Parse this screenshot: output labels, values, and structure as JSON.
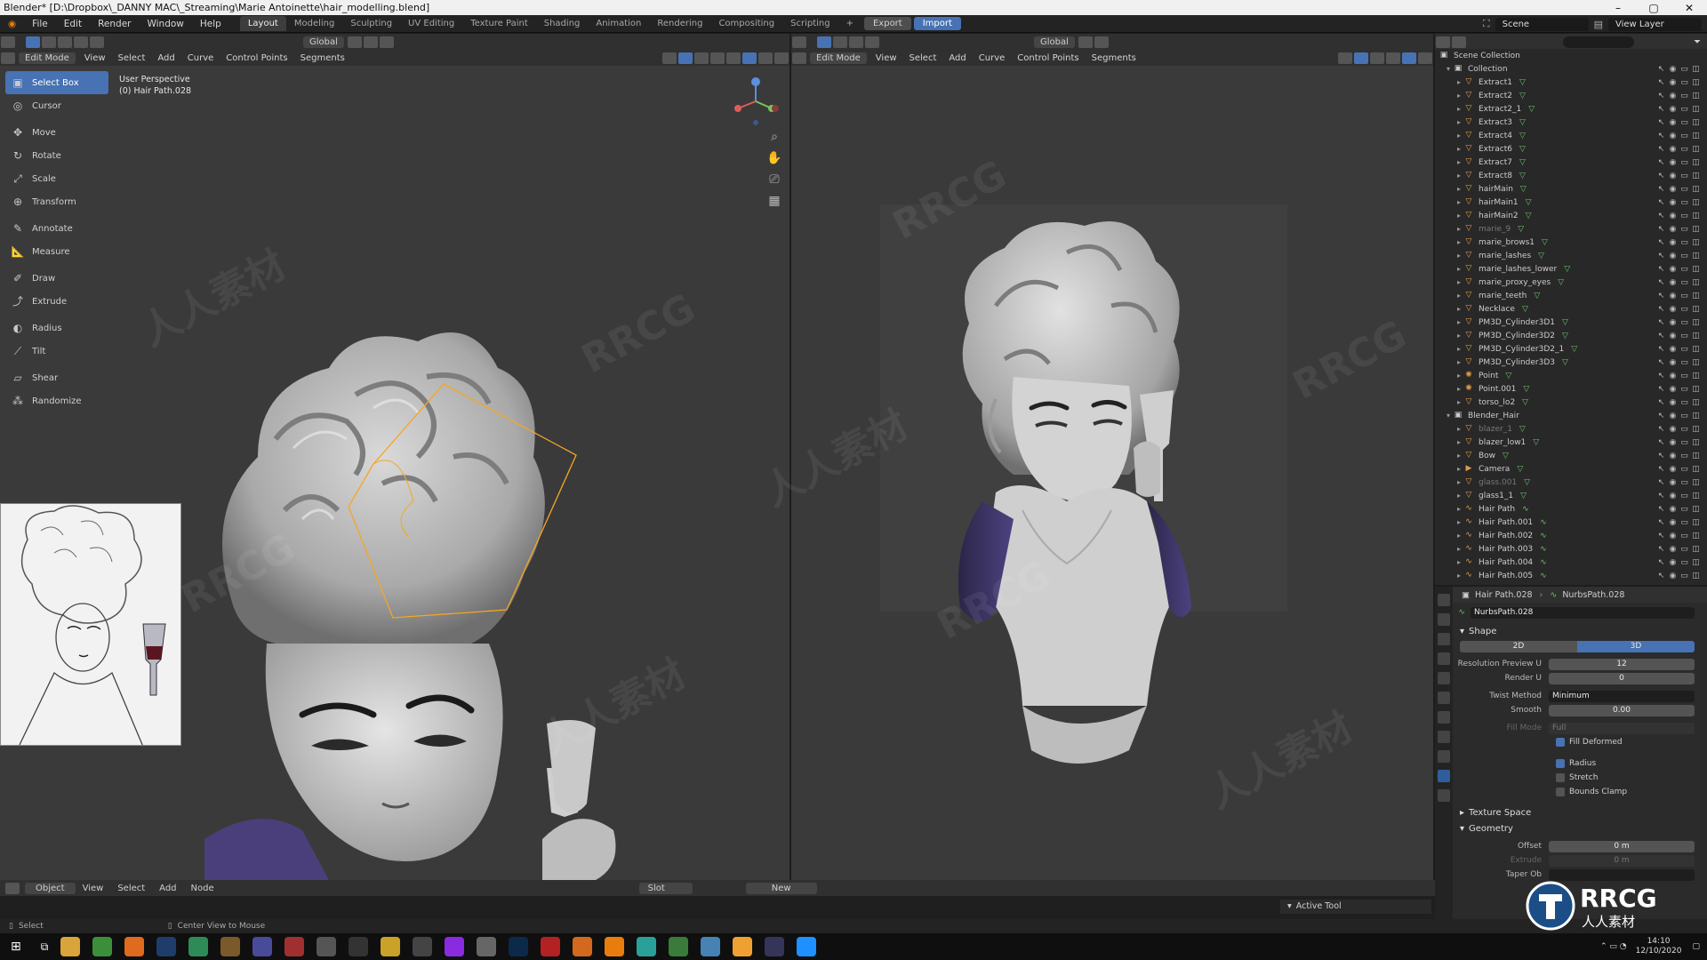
{
  "window": {
    "title": "Blender* [D:\\Dropbox\\_DANNY MAC\\_Streaming\\Marie Antoinette\\hair_modelling.blend]",
    "controls": [
      "–",
      "▢",
      "✕"
    ]
  },
  "topbar": {
    "menus": [
      "File",
      "Edit",
      "Render",
      "Window",
      "Help"
    ],
    "workspaces": [
      "Layout",
      "Modeling",
      "Sculpting",
      "UV Editing",
      "Texture Paint",
      "Shading",
      "Animation",
      "Rendering",
      "Compositing",
      "Scripting"
    ],
    "active_workspace": "Layout",
    "add_tab": "+",
    "export_label": "Export",
    "import_label": "Import",
    "scene_label": "Scene",
    "view_layer_label": "View Layer"
  },
  "left_view": {
    "mode": "Edit Mode",
    "menus": [
      "View",
      "Select",
      "Add",
      "Curve",
      "Control Points",
      "Segments"
    ],
    "orientation": "Global",
    "perspective": "User Perspective",
    "object": "(0) Hair Path.028"
  },
  "right_view": {
    "mode": "Edit Mode",
    "menus": [
      "View",
      "Select",
      "Add",
      "Curve",
      "Control Points",
      "Segments"
    ],
    "orientation": "Global"
  },
  "tools": [
    {
      "label": "Select Box",
      "icon": "▣",
      "active": true
    },
    {
      "label": "Cursor",
      "icon": "◎"
    },
    {
      "label": "Move",
      "icon": "✥"
    },
    {
      "label": "Rotate",
      "icon": "↻"
    },
    {
      "label": "Scale",
      "icon": "⤢"
    },
    {
      "label": "Transform",
      "icon": "⊕"
    },
    {
      "label": "Annotate",
      "icon": "✎"
    },
    {
      "label": "Measure",
      "icon": "📐"
    },
    {
      "label": "Draw",
      "icon": "✐"
    },
    {
      "label": "Extrude",
      "icon": "⤴"
    },
    {
      "label": "Radius",
      "icon": "◐"
    },
    {
      "label": "Tilt",
      "icon": "⟋"
    },
    {
      "label": "Shear",
      "icon": "▱"
    },
    {
      "label": "Randomize",
      "icon": "⁂"
    }
  ],
  "outliner": {
    "root": "Scene Collection",
    "rows": [
      {
        "name": "Collection",
        "type": "collection",
        "level": 1
      },
      {
        "name": "Extract1",
        "level": 2
      },
      {
        "name": "Extract2",
        "level": 2
      },
      {
        "name": "Extract2_1",
        "level": 2
      },
      {
        "name": "Extract3",
        "level": 2
      },
      {
        "name": "Extract4",
        "level": 2
      },
      {
        "name": "Extract6",
        "level": 2
      },
      {
        "name": "Extract7",
        "level": 2
      },
      {
        "name": "Extract8",
        "level": 2
      },
      {
        "name": "hairMain",
        "level": 2
      },
      {
        "name": "hairMain1",
        "level": 2
      },
      {
        "name": "hairMain2",
        "level": 2
      },
      {
        "name": "marie_9",
        "level": 2,
        "dim": true
      },
      {
        "name": "marie_brows1",
        "level": 2
      },
      {
        "name": "marie_lashes",
        "level": 2
      },
      {
        "name": "marie_lashes_lower",
        "level": 2
      },
      {
        "name": "marie_proxy_eyes",
        "level": 2
      },
      {
        "name": "marie_teeth",
        "level": 2
      },
      {
        "name": "Necklace",
        "level": 2
      },
      {
        "name": "PM3D_Cylinder3D1",
        "level": 2
      },
      {
        "name": "PM3D_Cylinder3D2",
        "level": 2
      },
      {
        "name": "PM3D_Cylinder3D2_1",
        "level": 2
      },
      {
        "name": "PM3D_Cylinder3D3",
        "level": 2
      },
      {
        "name": "Point",
        "level": 2,
        "type": "light"
      },
      {
        "name": "Point.001",
        "level": 2,
        "type": "light"
      },
      {
        "name": "torso_lo2",
        "level": 2
      },
      {
        "name": "Blender_Hair",
        "type": "collection",
        "level": 1
      },
      {
        "name": "blazer_1",
        "level": 2,
        "dim": true
      },
      {
        "name": "blazer_low1",
        "level": 2
      },
      {
        "name": "Bow",
        "level": 2
      },
      {
        "name": "Camera",
        "level": 2,
        "type": "camera"
      },
      {
        "name": "glass.001",
        "level": 2,
        "dim": true
      },
      {
        "name": "glass1_1",
        "level": 2
      },
      {
        "name": "Hair Path",
        "level": 2,
        "type": "curve"
      },
      {
        "name": "Hair Path.001",
        "level": 2,
        "type": "curve"
      },
      {
        "name": "Hair Path.002",
        "level": 2,
        "type": "curve"
      },
      {
        "name": "Hair Path.003",
        "level": 2,
        "type": "curve"
      },
      {
        "name": "Hair Path.004",
        "level": 2,
        "type": "curve"
      },
      {
        "name": "Hair Path.005",
        "level": 2,
        "type": "curve"
      }
    ]
  },
  "properties": {
    "object_name": "Hair Path.028",
    "data_name": "NurbsPath.028",
    "datablock": "NurbsPath.028",
    "shape_title": "Shape",
    "mode_2d": "2D",
    "mode_3d": "3D",
    "resolution_preview_u_label": "Resolution Preview U",
    "resolution_preview_u": "12",
    "render_u_label": "Render U",
    "render_u": "0",
    "twist_method_label": "Twist Method",
    "twist_method": "Minimum",
    "smooth_label": "Smooth",
    "smooth": "0.00",
    "fill_mode_label": "Fill Mode",
    "fill_mode": "Full",
    "fill_deformed": "Fill Deformed",
    "radius": "Radius",
    "stretch": "Stretch",
    "bounds_clamp": "Bounds Clamp",
    "texture_space": "Texture Space",
    "geometry": "Geometry",
    "offset_label": "Offset",
    "offset": "0 m",
    "extrude_label": "Extrude",
    "extrude": "0 m",
    "taper_label": "Taper Ob"
  },
  "node_editor": {
    "type": "Object",
    "menus": [
      "View",
      "Select",
      "Add",
      "Node"
    ],
    "slot": "Slot",
    "new_label": "New"
  },
  "active_tool_label": "Active Tool",
  "status": {
    "select": "Select",
    "center_view": "Center View to Mouse"
  },
  "tray": {
    "time": "14:10",
    "date": "12/10/2020"
  },
  "watermark": {
    "latin": "RRCG",
    "cjk": "人人素材"
  }
}
